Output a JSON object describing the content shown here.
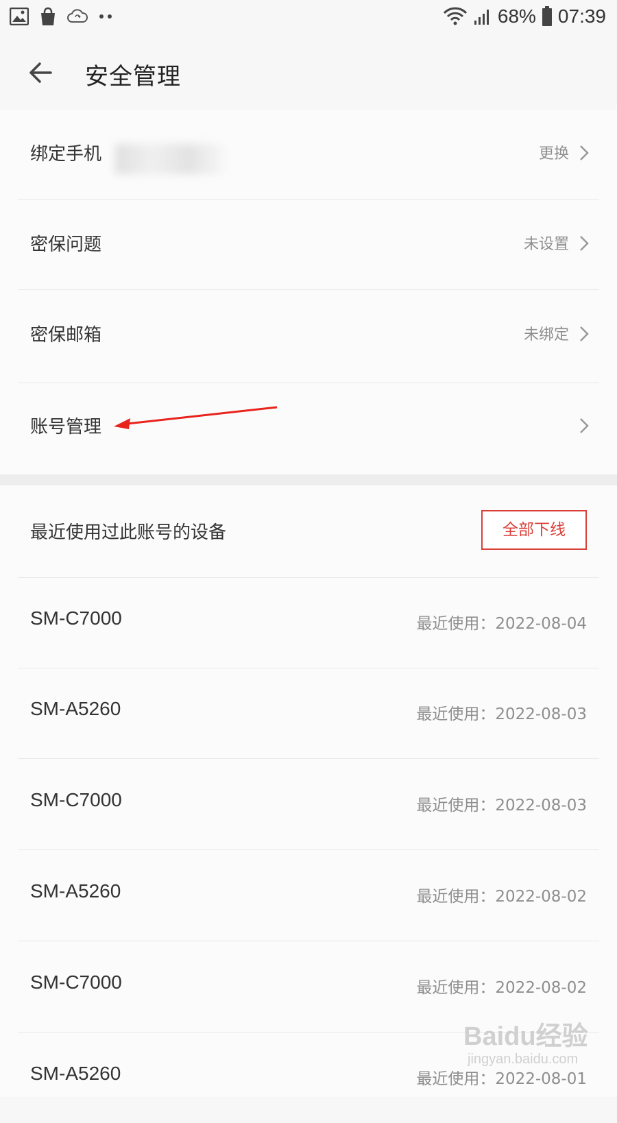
{
  "status_bar": {
    "battery": "68%",
    "time": "07:39",
    "left_icons": [
      "gallery-icon",
      "shopping-bag-icon",
      "cloud-sync-icon",
      "more-dots-icon"
    ],
    "right_icons": [
      "wifi-icon",
      "signal-icon",
      "battery-icon"
    ]
  },
  "header": {
    "title": "安全管理",
    "back_icon": "back-arrow-icon"
  },
  "security_items": [
    {
      "label": "绑定手机",
      "value": "更换"
    },
    {
      "label": "密保问题",
      "value": "未设置"
    },
    {
      "label": "密保邮箱",
      "value": "未绑定"
    },
    {
      "label": "账号管理",
      "value": ""
    }
  ],
  "devices": {
    "title": "最近使用过此账号的设备",
    "logout_all_label": "全部下线",
    "list": [
      {
        "name": "SM-C7000",
        "last_used": "最近使用：2022-08-04"
      },
      {
        "name": "SM-A5260",
        "last_used": "最近使用：2022-08-03"
      },
      {
        "name": "SM-C7000",
        "last_used": "最近使用：2022-08-03"
      },
      {
        "name": "SM-A5260",
        "last_used": "最近使用：2022-08-02"
      },
      {
        "name": "SM-C7000",
        "last_used": "最近使用：2022-08-02"
      },
      {
        "name": "SM-A5260",
        "last_used": "最近使用：2022-08-01"
      }
    ]
  },
  "colors": {
    "accent_red": "#d9403a",
    "annotation_arrow": "#e8231c"
  },
  "watermark": {
    "main": "Baidu经验",
    "sub": "jingyan.baidu.com"
  }
}
